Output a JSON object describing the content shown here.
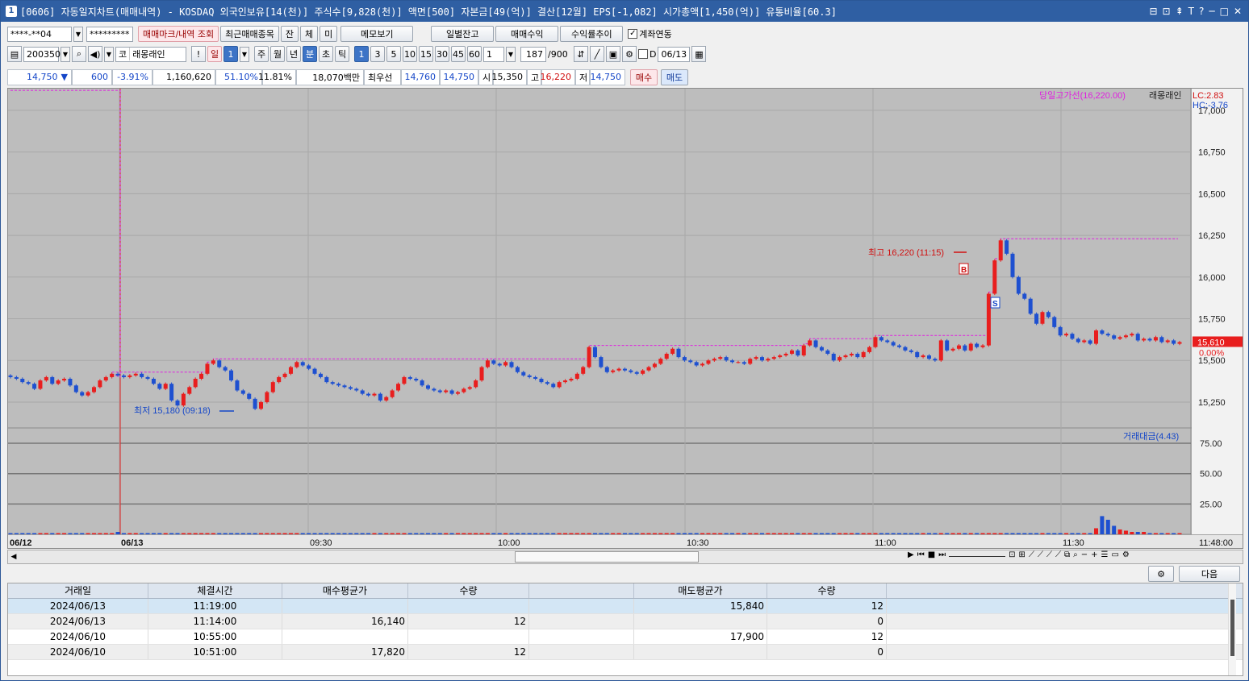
{
  "window": {
    "tab_number": "1",
    "title": "[0606] 자동일지차트(매매내역) - KOSDAQ 외국인보유[14(천)] 주식수[9,828(천)] 액면[500] 자본금[49(억)] 결산[12월] EPS[-1,082] 시가총액[1,450(억)] 유통비율[60.3]",
    "controls": [
      "⊟",
      "⊡",
      "⇞",
      "T",
      "?",
      "─",
      "□",
      "✕"
    ]
  },
  "toolbar1": {
    "account": "****-**04",
    "password": "*********",
    "btn_trade_mark": "매매마크/내역 조회",
    "btn_recent": "최근매매종목",
    "btn_jan": "잔",
    "btn_che": "체",
    "btn_mi": "미",
    "btn_memo": "메모보기",
    "btn_daily": "일별잔고",
    "btn_profit": "매매수익",
    "btn_return": "수익률추이",
    "chk_account_link": "계좌연동"
  },
  "toolbar2": {
    "code": "200350",
    "market_prefix": "코",
    "stock_name": "래몽래인",
    "excl": "!",
    "period_il": "일",
    "period_num": "1",
    "ju": "주",
    "wol": "월",
    "nyeon": "년",
    "bun": "분",
    "cho": "초",
    "tik": "틱",
    "intervals": [
      "1",
      "3",
      "5",
      "10",
      "15",
      "30",
      "45",
      "60"
    ],
    "interval_select": "1",
    "count": "187",
    "count_max": "/900",
    "chk_d": "D",
    "date": "06/13"
  },
  "inforow": {
    "price": "14,750",
    "arrow": "▼",
    "change": "600",
    "change_pct": "-3.91%",
    "volume": "1,160,620",
    "vol_ratio": "51.10%",
    "turnover": "11.81%",
    "amount": "18,070백만",
    "best_label": "최우선",
    "best_sell": "14,760",
    "best_buy": "14,750",
    "open_label": "시",
    "open": "15,350",
    "high_label": "고",
    "high": "16,220",
    "low_label": "저",
    "low": "14,750",
    "buy_btn": "매수",
    "sell_btn": "매도"
  },
  "chart": {
    "legend_high_line": "당일고가선(16,220.00)",
    "legend_name": "래몽래인",
    "lc": "LC:2.83",
    "hc": "HC:-3.76",
    "high_annot": "최고 16,220 (11:15)",
    "low_annot": "최저 15,180 (09:18)",
    "current_price_tag": "15,610",
    "current_pct_tag": "0.00%",
    "volume_legend": "거래대금(4.43)",
    "buy_marker": "B",
    "sell_marker": "S",
    "price_ticks": [
      "17,000",
      "16,750",
      "16,500",
      "16,250",
      "16,000",
      "15,750",
      "15,500",
      "15,250"
    ],
    "vol_ticks": [
      "75.00",
      "50.00",
      "25.00"
    ],
    "time_labels": [
      "06/12",
      "06/13",
      "09:30",
      "10:00",
      "10:30",
      "11:00",
      "11:30"
    ],
    "time_end": "11:48:00",
    "colors": {
      "up": "#e81e1e",
      "down": "#1e50d0",
      "line": "#e020e0",
      "bg": "#bdbdbd"
    }
  },
  "chart_data": {
    "type": "candlestick",
    "title": "",
    "xlabel": "",
    "ylabel": "",
    "ylim": [
      15100,
      17130
    ],
    "y2lim": [
      0,
      85
    ],
    "day_high": 16220,
    "day_low": 15180,
    "current": 15610,
    "closes": [
      15400,
      15390,
      15370,
      15360,
      15330,
      15380,
      15400,
      15360,
      15380,
      15390,
      15350,
      15310,
      15290,
      15310,
      15340,
      15380,
      15400,
      15420,
      15410,
      15400,
      15410,
      15420,
      15400,
      15390,
      15360,
      15330,
      15360,
      15260,
      15230,
      15300,
      15340,
      15390,
      15420,
      15480,
      15500,
      15460,
      15440,
      15380,
      15320,
      15300,
      15270,
      15210,
      15250,
      15310,
      15370,
      15400,
      15420,
      15460,
      15490,
      15470,
      15450,
      15420,
      15400,
      15370,
      15360,
      15350,
      15340,
      15330,
      15320,
      15300,
      15290,
      15300,
      15260,
      15280,
      15320,
      15360,
      15400,
      15390,
      15380,
      15350,
      15330,
      15320,
      15310,
      15320,
      15300,
      15310,
      15330,
      15340,
      15380,
      15460,
      15500,
      15480,
      15470,
      15490,
      15460,
      15430,
      15410,
      15400,
      15390,
      15370,
      15360,
      15340,
      15370,
      15380,
      15390,
      15420,
      15460,
      15580,
      15520,
      15460,
      15430,
      15440,
      15450,
      15440,
      15430,
      15420,
      15440,
      15460,
      15480,
      15510,
      15540,
      15570,
      15520,
      15500,
      15490,
      15470,
      15480,
      15500,
      15510,
      15520,
      15500,
      15490,
      15490,
      15480,
      15510,
      15520,
      15500,
      15510,
      15520,
      15530,
      15540,
      15560,
      15530,
      15590,
      15620,
      15580,
      15560,
      15540,
      15500,
      15520,
      15530,
      15540,
      15520,
      15550,
      15580,
      15640,
      15620,
      15610,
      15590,
      15580,
      15560,
      15550,
      15520,
      15530,
      15510,
      15500,
      15620,
      15560,
      15570,
      15590,
      15560,
      15600,
      15580,
      15590,
      15900,
      16100,
      16220,
      16140,
      16000,
      15900,
      15870,
      15780,
      15720,
      15790,
      15760,
      15700,
      15650,
      15660,
      15630,
      15610,
      15620,
      15600,
      15680,
      15660,
      15650,
      15630,
      15640,
      15650,
      15660,
      15620,
      15630,
      15620,
      15640,
      15610,
      15620,
      15600,
      15610
    ],
    "volumes": [
      1,
      1,
      1,
      1,
      1,
      1,
      1,
      1,
      1,
      1,
      1,
      1,
      1,
      1,
      1,
      1,
      1,
      1,
      2,
      1,
      1,
      1,
      1,
      1,
      1,
      1,
      1,
      1,
      1,
      1,
      1,
      1,
      1,
      1,
      1,
      1,
      1,
      1,
      1,
      1,
      1,
      1,
      1,
      1,
      1,
      1,
      1,
      1,
      1,
      1,
      1,
      1,
      1,
      1,
      1,
      1,
      1,
      1,
      1,
      1,
      1,
      1,
      1,
      1,
      1,
      1,
      1,
      1,
      1,
      1,
      1,
      1,
      1,
      1,
      1,
      1,
      1,
      1,
      1,
      1,
      1,
      1,
      1,
      1,
      1,
      1,
      1,
      1,
      1,
      1,
      1,
      1,
      1,
      1,
      1,
      1,
      1,
      1,
      1,
      1,
      1,
      1,
      1,
      1,
      1,
      1,
      1,
      1,
      1,
      1,
      1,
      1,
      1,
      1,
      1,
      1,
      1,
      1,
      1,
      1,
      1,
      1,
      1,
      1,
      1,
      1,
      1,
      1,
      1,
      1,
      1,
      1,
      1,
      1,
      1,
      1,
      1,
      1,
      1,
      1,
      1,
      1,
      1,
      1,
      1,
      1,
      1,
      1,
      1,
      1,
      1,
      1,
      1,
      1,
      1,
      1,
      1,
      1,
      1,
      1,
      1,
      1,
      1,
      1,
      1,
      1,
      1,
      1,
      1,
      1,
      1,
      1,
      1,
      1,
      1,
      1,
      1,
      1,
      1,
      1,
      1,
      1,
      5,
      15,
      12,
      7,
      4,
      3,
      2,
      2,
      2,
      1,
      1,
      1,
      1,
      1,
      1,
      1,
      1,
      1,
      1,
      1,
      1,
      1,
      1,
      1,
      1,
      1,
      1,
      1,
      1,
      1,
      1,
      1,
      1
    ]
  },
  "trades_table": {
    "headers": [
      "거래일",
      "체결시간",
      "매수평균가",
      "수량",
      "",
      "매도평균가",
      "수량"
    ],
    "rows": [
      [
        "2024/06/13",
        "11:19:00",
        "",
        "",
        "",
        "15,840",
        "12"
      ],
      [
        "2024/06/13",
        "11:14:00",
        "16,140",
        "12",
        "",
        "",
        "0"
      ],
      [
        "2024/06/10",
        "10:55:00",
        "",
        "",
        "",
        "17,900",
        "12"
      ],
      [
        "2024/06/10",
        "10:51:00",
        "17,820",
        "12",
        "",
        "",
        "0"
      ]
    ],
    "next_btn": "다음"
  }
}
